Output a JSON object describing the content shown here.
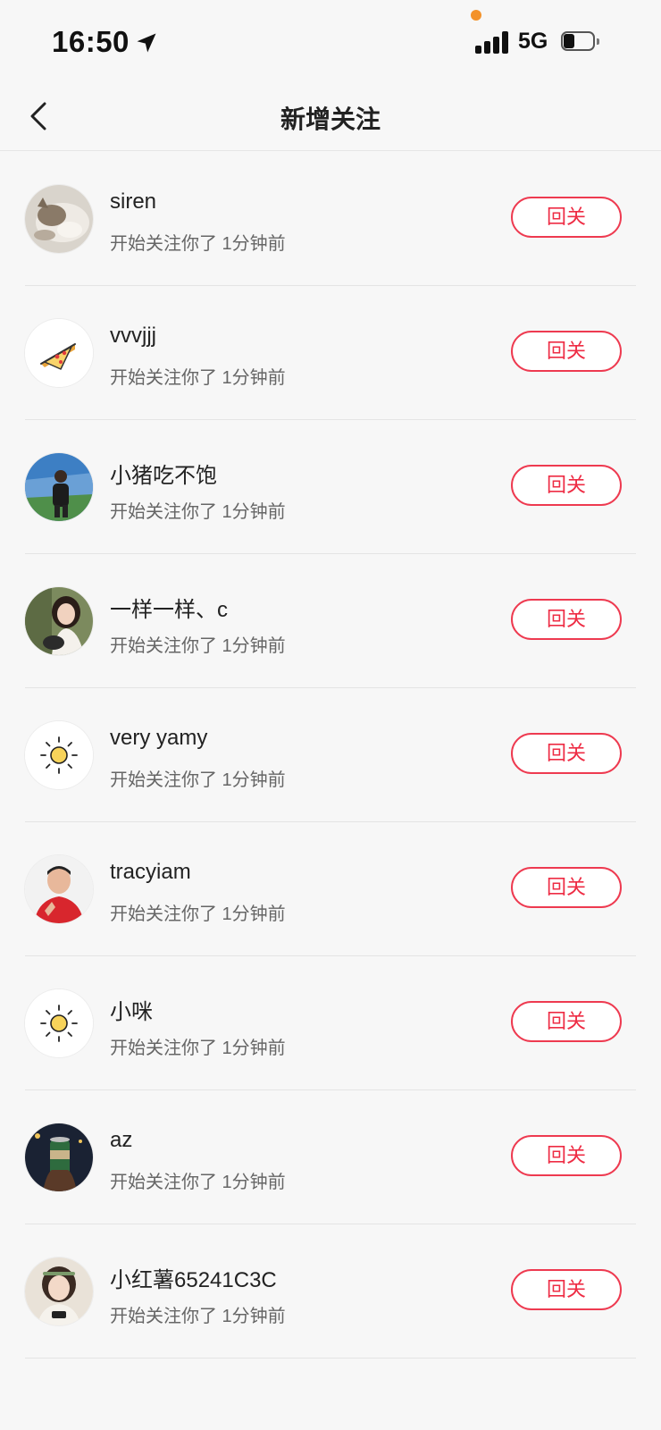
{
  "status_bar": {
    "time": "16:50",
    "network": "5G"
  },
  "nav": {
    "title": "新增关注"
  },
  "followers": [
    {
      "name": "siren",
      "subtitle": "开始关注你了 1分钟前",
      "action": "回关",
      "avatar": "cat-photo"
    },
    {
      "name": "vvvjjj",
      "subtitle": "开始关注你了 1分钟前",
      "action": "回关",
      "avatar": "pizza-slice-icon"
    },
    {
      "name": "小猪吃不饱",
      "subtitle": "开始关注你了 1分钟前",
      "action": "回关",
      "avatar": "person-outdoor-photo"
    },
    {
      "name": "一样一样、c",
      "subtitle": "开始关注你了 1分钟前",
      "action": "回关",
      "avatar": "girl-photo"
    },
    {
      "name": "very yamy",
      "subtitle": "开始关注你了 1分钟前",
      "action": "回关",
      "avatar": "sun-icon"
    },
    {
      "name": "tracyiam",
      "subtitle": "开始关注你了 1分钟前",
      "action": "回关",
      "avatar": "boy-red-shirt-photo"
    },
    {
      "name": "小咪",
      "subtitle": "开始关注你了 1分钟前",
      "action": "回关",
      "avatar": "sun-icon"
    },
    {
      "name": "az",
      "subtitle": "开始关注你了 1分钟前",
      "action": "回关",
      "avatar": "can-photo"
    },
    {
      "name": "小红薯65241C3C",
      "subtitle": "开始关注你了 1分钟前",
      "action": "回关",
      "avatar": "woman-photo"
    }
  ],
  "colors": {
    "accent": "#ee2c44",
    "background": "#f7f7f7",
    "divider": "#e4e4e4"
  }
}
